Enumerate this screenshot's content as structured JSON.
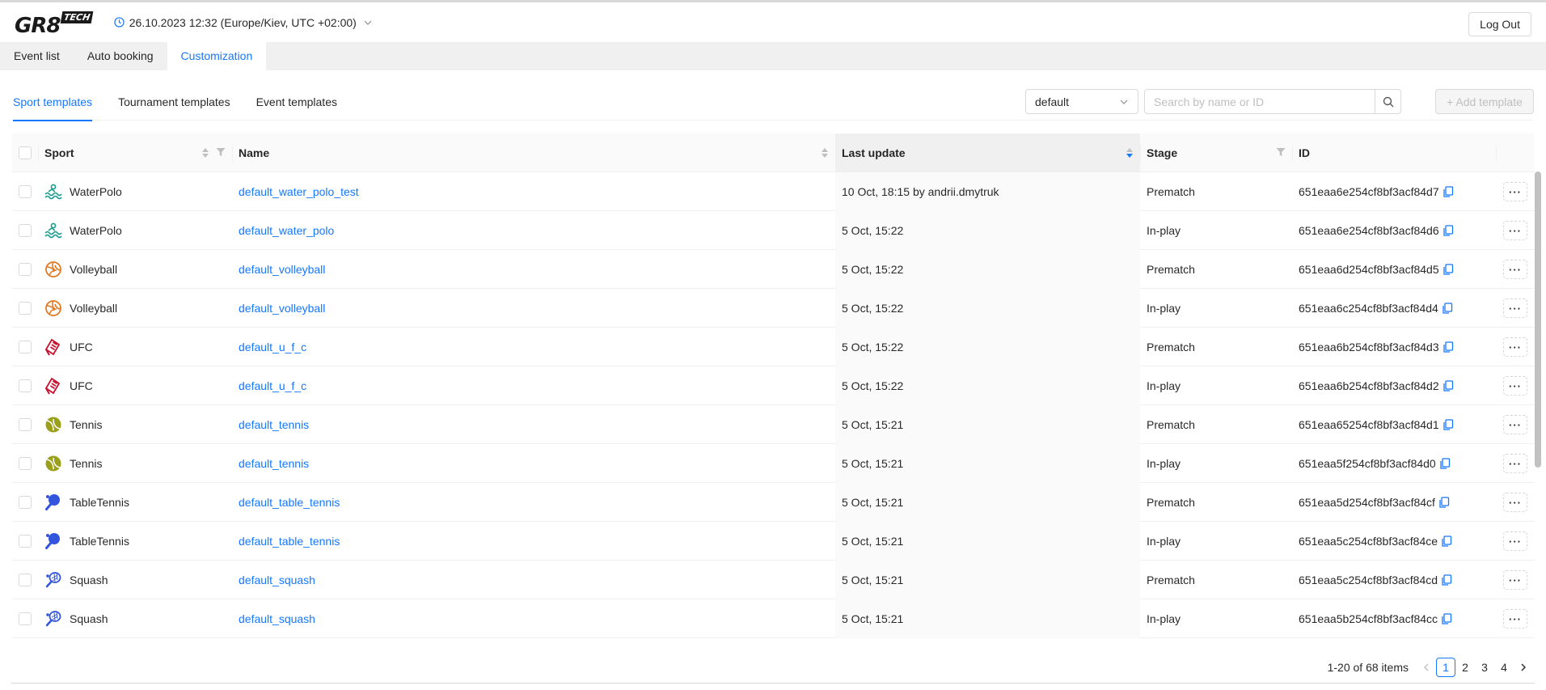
{
  "header": {
    "logo_main": "GR8",
    "logo_badge": "TECH",
    "datetime": "26.10.2023 12:32 (Europe/Kiev, UTC +02:00)",
    "logout_label": "Log Out"
  },
  "nav": {
    "tabs": [
      {
        "label": "Event list",
        "active": false
      },
      {
        "label": "Auto booking",
        "active": false
      },
      {
        "label": "Customization",
        "active": true
      }
    ]
  },
  "subtabs": [
    {
      "label": "Sport templates",
      "active": true
    },
    {
      "label": "Tournament templates",
      "active": false
    },
    {
      "label": "Event templates",
      "active": false
    }
  ],
  "toolbar": {
    "select_value": "default",
    "search_placeholder": "Search by name or ID",
    "add_label": "+ Add template"
  },
  "table": {
    "columns": {
      "sport": "Sport",
      "name": "Name",
      "last_update": "Last update",
      "stage": "Stage",
      "id": "ID"
    },
    "rows": [
      {
        "sport": "WaterPolo",
        "icon": "waterpolo",
        "name": "default_water_polo_test",
        "last_update": "10 Oct, 18:15 by andrii.dmytruk",
        "stage": "Prematch",
        "id": "651eaa6e254cf8bf3acf84d7"
      },
      {
        "sport": "WaterPolo",
        "icon": "waterpolo",
        "name": "default_water_polo",
        "last_update": "5 Oct, 15:22",
        "stage": "In-play",
        "id": "651eaa6e254cf8bf3acf84d6"
      },
      {
        "sport": "Volleyball",
        "icon": "volleyball",
        "name": "default_volleyball",
        "last_update": "5 Oct, 15:22",
        "stage": "Prematch",
        "id": "651eaa6d254cf8bf3acf84d5"
      },
      {
        "sport": "Volleyball",
        "icon": "volleyball",
        "name": "default_volleyball",
        "last_update": "5 Oct, 15:22",
        "stage": "In-play",
        "id": "651eaa6c254cf8bf3acf84d4"
      },
      {
        "sport": "UFC",
        "icon": "ufc",
        "name": "default_u_f_c",
        "last_update": "5 Oct, 15:22",
        "stage": "Prematch",
        "id": "651eaa6b254cf8bf3acf84d3"
      },
      {
        "sport": "UFC",
        "icon": "ufc",
        "name": "default_u_f_c",
        "last_update": "5 Oct, 15:22",
        "stage": "In-play",
        "id": "651eaa6b254cf8bf3acf84d2"
      },
      {
        "sport": "Tennis",
        "icon": "tennis",
        "name": "default_tennis",
        "last_update": "5 Oct, 15:21",
        "stage": "Prematch",
        "id": "651eaa65254cf8bf3acf84d1"
      },
      {
        "sport": "Tennis",
        "icon": "tennis",
        "name": "default_tennis",
        "last_update": "5 Oct, 15:21",
        "stage": "In-play",
        "id": "651eaa5f254cf8bf3acf84d0"
      },
      {
        "sport": "TableTennis",
        "icon": "tabletennis",
        "name": "default_table_tennis",
        "last_update": "5 Oct, 15:21",
        "stage": "Prematch",
        "id": "651eaa5d254cf8bf3acf84cf"
      },
      {
        "sport": "TableTennis",
        "icon": "tabletennis",
        "name": "default_table_tennis",
        "last_update": "5 Oct, 15:21",
        "stage": "In-play",
        "id": "651eaa5c254cf8bf3acf84ce"
      },
      {
        "sport": "Squash",
        "icon": "squash",
        "name": "default_squash",
        "last_update": "5 Oct, 15:21",
        "stage": "Prematch",
        "id": "651eaa5c254cf8bf3acf84cd"
      },
      {
        "sport": "Squash",
        "icon": "squash",
        "name": "default_squash",
        "last_update": "5 Oct, 15:21",
        "stage": "In-play",
        "id": "651eaa5b254cf8bf3acf84cc"
      }
    ]
  },
  "pagination": {
    "total": "1-20 of 68 items",
    "pages": [
      "1",
      "2",
      "3",
      "4"
    ],
    "current": "1"
  },
  "colors": {
    "accent": "#1677ff",
    "waterpolo": "#1a9c8c",
    "volleyball": "#e07b22",
    "ufc": "#c8102e",
    "tennis": "#9aa01a",
    "tabletennis": "#3355dd",
    "squash": "#3355dd"
  }
}
